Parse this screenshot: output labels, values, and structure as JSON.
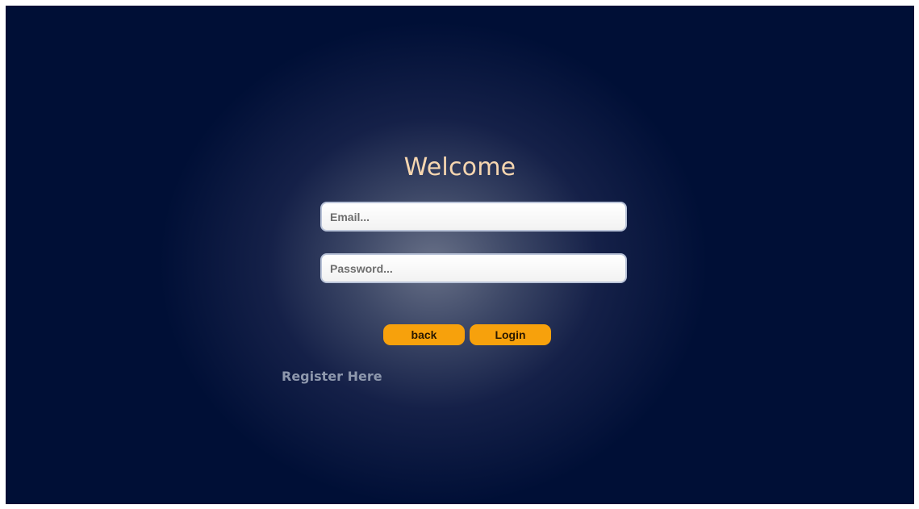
{
  "header": {
    "title": "Welcome"
  },
  "form": {
    "email": {
      "value": "",
      "placeholder": "Email..."
    },
    "password": {
      "value": "",
      "placeholder": "Password..."
    }
  },
  "actions": {
    "back_label": "back",
    "login_label": "Login",
    "register_label": "Register Here"
  },
  "colors": {
    "background": "#000f36",
    "title": "#f6d6b0",
    "button": "#f7a10c",
    "register_link": "#8e98ad"
  }
}
